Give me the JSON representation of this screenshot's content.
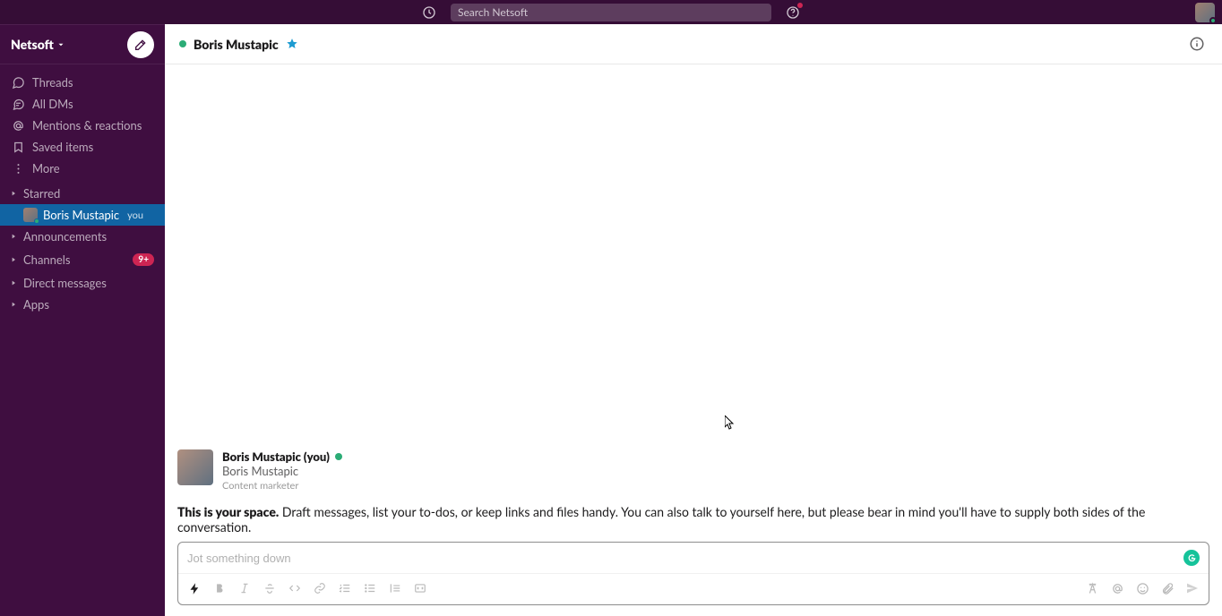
{
  "topbar": {
    "search_placeholder": "Search Netsoft"
  },
  "workspace": {
    "name": "Netsoft"
  },
  "nav": {
    "threads": "Threads",
    "all_dms": "All DMs",
    "mentions": "Mentions & reactions",
    "saved": "Saved items",
    "more": "More"
  },
  "sections": {
    "starred": {
      "label": "Starred"
    },
    "self_dm": {
      "name": "Boris Mustapic",
      "you": "you"
    },
    "announcements": {
      "label": "Announcements"
    },
    "channels": {
      "label": "Channels",
      "badge": "9+"
    },
    "dms": {
      "label": "Direct messages"
    },
    "apps": {
      "label": "Apps"
    }
  },
  "chat": {
    "title": "Boris Mustapic",
    "intro": {
      "name": "Boris Mustapic (you)",
      "display_name": "Boris Mustapic",
      "role": "Content marketer",
      "desc_bold": "This is your space.",
      "desc_rest": " Draft messages, list your to-dos, or keep links and files handy. You can also talk to yourself here, but please bear in mind you'll have to supply both sides of the conversation."
    },
    "composer_placeholder": "Jot something down"
  }
}
